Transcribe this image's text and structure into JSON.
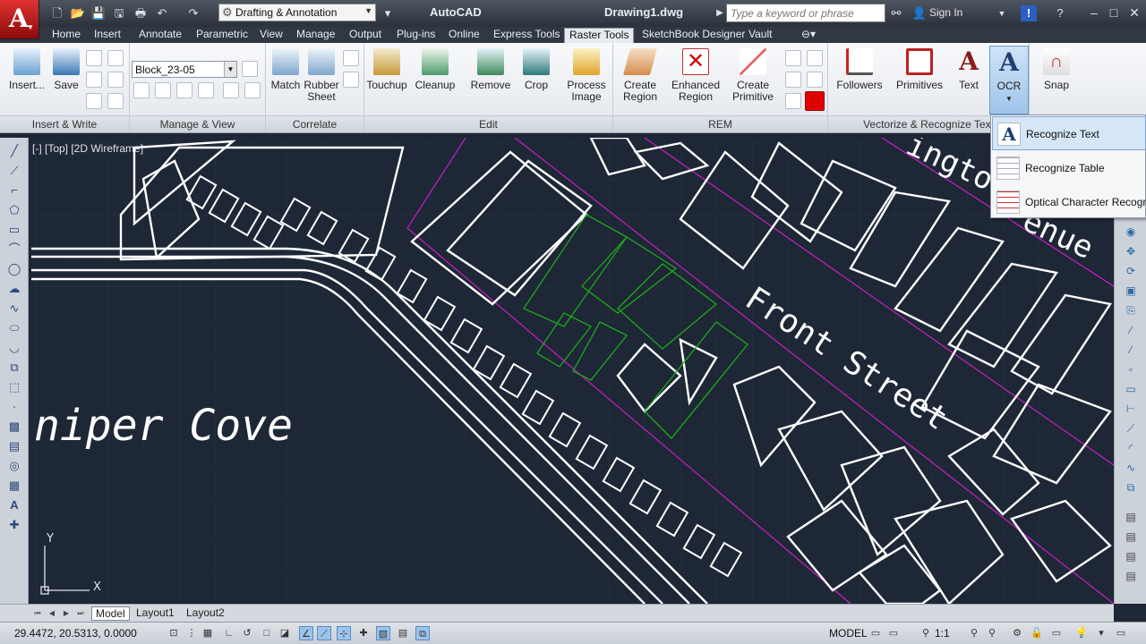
{
  "titlebar": {
    "workspace": "Drafting & Annotation",
    "app_name": "AutoCAD",
    "doc_name": "Drawing1.dwg",
    "search_placeholder": "Type a keyword or phrase",
    "signin": "Sign In"
  },
  "tabs": [
    "Home",
    "Insert",
    "Annotate",
    "Parametric",
    "View",
    "Manage",
    "Output",
    "Plug-ins",
    "Online",
    "Express Tools",
    "Raster Tools",
    "SketchBook Designer",
    "Vault"
  ],
  "active_tab": "Raster Tools",
  "ribbon": {
    "insert_label": "Insert...",
    "save_label": "Save",
    "panel_insert_write": "Insert & Write",
    "layer_combo": "Block_23-05",
    "panel_manage_view": "Manage & View",
    "match_label": "Match",
    "rubber_sheet_label_1": "Rubber",
    "rubber_sheet_label_2": "Sheet",
    "panel_correlate": "Correlate",
    "touchup_label": "Touchup",
    "cleanup_label": "Cleanup",
    "remove_label": "Remove",
    "crop_label": "Crop",
    "process_image_1": "Process",
    "process_image_2": "Image",
    "panel_edit": "Edit",
    "create_region_1": "Create",
    "create_region_2": "Region",
    "enhanced_region_1": "Enhanced",
    "enhanced_region_2": "Region",
    "create_primitive_1": "Create",
    "create_primitive_2": "Primitive",
    "panel_rem": "REM",
    "followers_label": "Followers",
    "primitives_label": "Primitives",
    "text_label": "Text",
    "ocr_label": "OCR",
    "panel_vectorize": "Vectorize & Recognize Text",
    "snap_label": "Snap"
  },
  "ocr_menu": [
    "Recognize Text",
    "Recognize Table",
    "Optical Character Recognition"
  ],
  "viewport_label": "[-] [Top] [2D Wireframe]",
  "drawing_text": {
    "cove": "niper Cove",
    "front_street": "Front Street",
    "avenue_top": "ington",
    "avenue_bottom": "enue"
  },
  "ucs": {
    "x": "X",
    "y": "Y"
  },
  "layout_tabs": [
    "Model",
    "Layout1",
    "Layout2"
  ],
  "status": {
    "coords": "29.4472, 20.5313, 0.0000",
    "model": "MODEL",
    "scale": "1:1"
  },
  "colors": {
    "canvas": "#1e2735",
    "building": "#ffffff",
    "highlight": "#1fa81f",
    "property_line": "#c51fc5",
    "accent": "#c41d1d"
  }
}
